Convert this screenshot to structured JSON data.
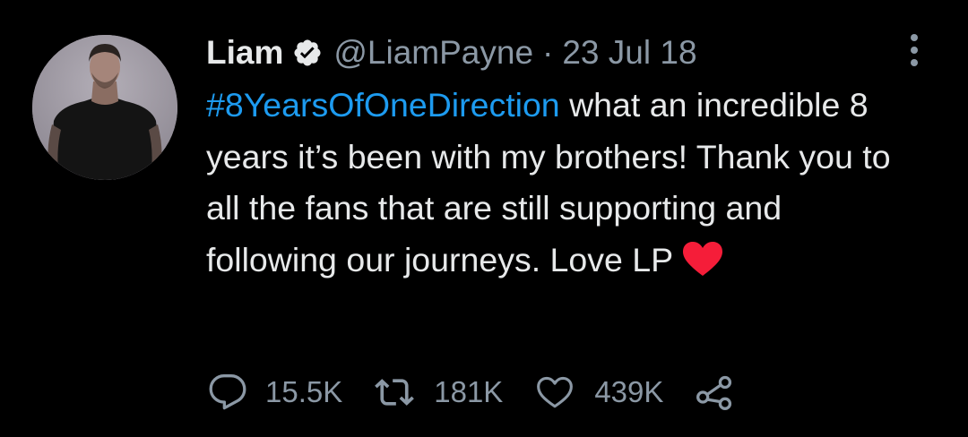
{
  "tweet": {
    "author_name": "Liam",
    "handle": "@LiamPayne",
    "separator": "·",
    "date": "23 Jul 18",
    "hashtag": "#8YearsOfOneDirection",
    "text": " what an incredible 8 years it’s been with my brothers! Thank you to all the fans that are still supporting and following our journeys. Love LP",
    "emoji": "red-heart"
  },
  "actions": {
    "replies": "15.5K",
    "retweets": "181K",
    "likes": "439K"
  },
  "colors": {
    "background": "#000000",
    "text": "#e7e9ea",
    "secondary": "#8b98a5",
    "link": "#1d9bf0",
    "heart": "#f51d39"
  },
  "icons": {
    "verified": "verified-badge-icon",
    "more": "more-vertical-icon",
    "reply": "reply-icon",
    "retweet": "retweet-icon",
    "like": "like-icon",
    "share": "share-icon"
  }
}
